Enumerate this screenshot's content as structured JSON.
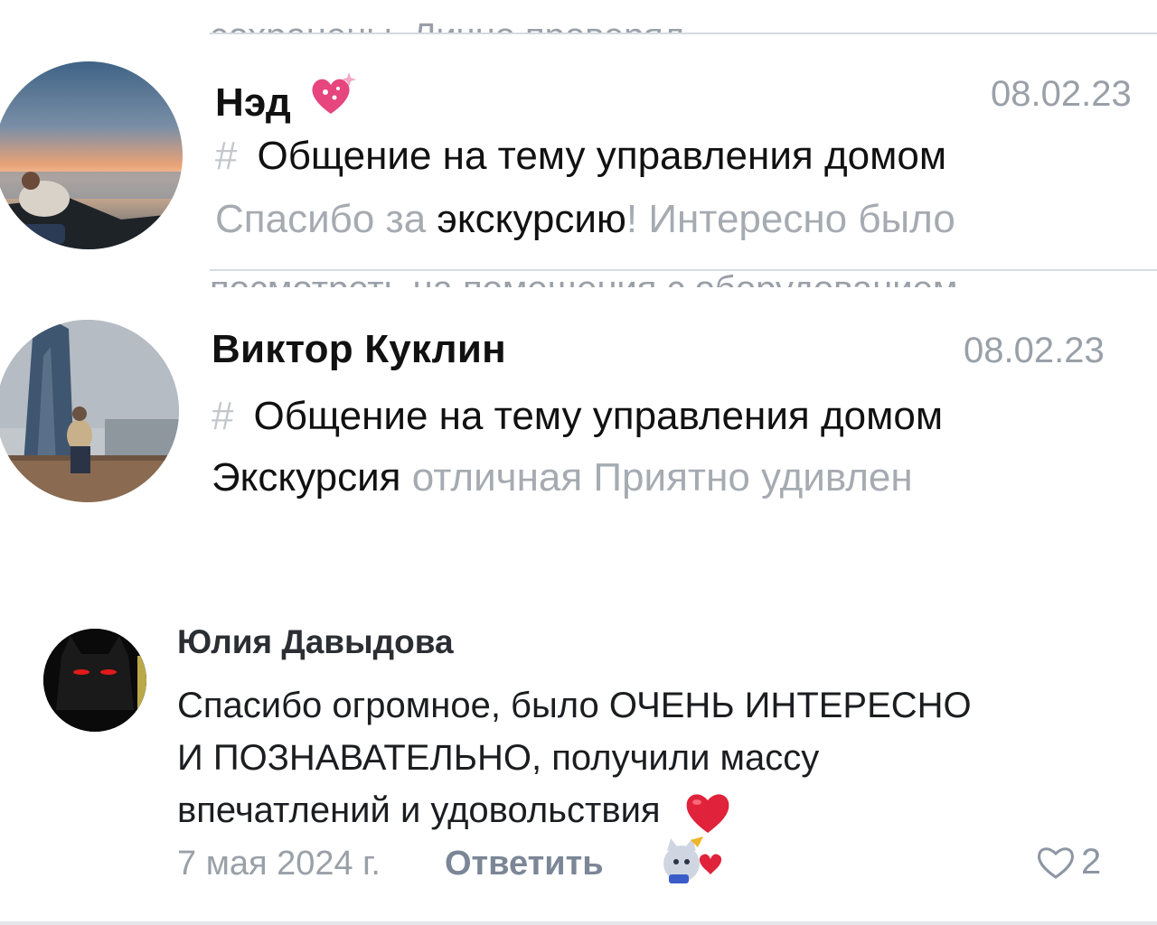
{
  "cut_lines": {
    "top": "сохранены. Лично проверял",
    "middle": "посмотреть на помещения с оборудованием"
  },
  "messages": [
    {
      "name": "Нэд",
      "name_emoji": "heart-sparkle-sticker",
      "date": "08.02.23",
      "topic": "Общение на тему управления домом",
      "preview_before": "Спасибо за ",
      "preview_highlight": "экскурсию",
      "preview_after": "! Интересно было"
    },
    {
      "name": "Виктор Куклин",
      "date": "08.02.23",
      "topic": "Общение на тему управления домом",
      "preview_highlight": "Экскурсия",
      "preview_after": " отличная Приятно удивлен"
    }
  ],
  "hash_symbol": "#",
  "comment": {
    "author": "Юлия Давыдова",
    "lines": [
      "Спасибо огромное, было ОЧЕНЬ ИНТЕРЕСНО",
      "И ПОЗНАВАТЕЛЬНО, получили массу",
      "впечатлений и удовольствия"
    ],
    "emoji": "red-heart",
    "date": "7 мая 2024 г.",
    "reply_label": "Ответить",
    "likes": "2"
  },
  "colors": {
    "muted_text": "#9aa0a8",
    "reply_link": "#7b8696",
    "heart": "#e0223b"
  }
}
